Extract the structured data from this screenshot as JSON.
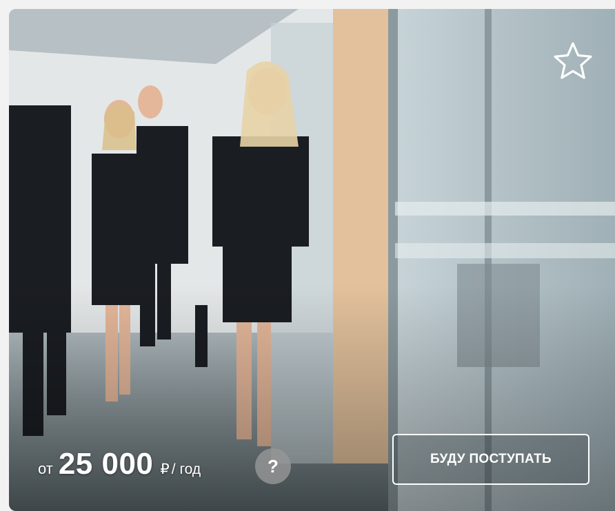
{
  "card": {
    "image_alt": "Офис",
    "favorite_icon": "star-outline-icon",
    "price": {
      "prefix": "от",
      "amount": "25 000",
      "currency": "₽",
      "period": "/ год"
    },
    "help_label": "?",
    "apply_button": "БУДУ ПОСТУПАТЬ"
  }
}
